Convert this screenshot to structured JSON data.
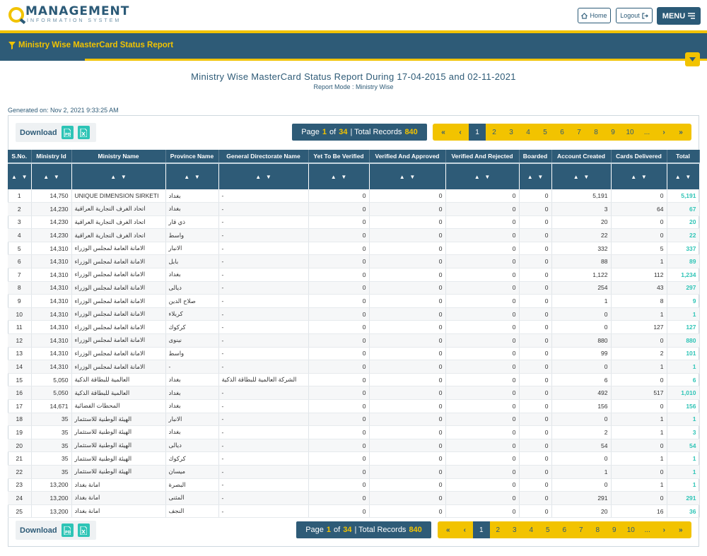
{
  "header": {
    "logo_main": "MANAGEMENT",
    "logo_sub": "INFORMATION SYSTEM",
    "home_label": "Home",
    "logout_label": "Logout",
    "menu_label": "MENU"
  },
  "titlebar": {
    "title": "Ministry Wise MasterCard Status Report"
  },
  "report": {
    "title": "Ministry Wise MasterCard Status Report During 17-04-2015 and 02-11-2021",
    "mode": "Report Mode : Ministry Wise",
    "generated": "Generated on: Nov 2, 2021 9:33:25 AM"
  },
  "download": {
    "label": "Download",
    "pdf_icon": "pdf-icon",
    "excel_icon": "excel-icon"
  },
  "paging": {
    "page_word": "Page",
    "page": "1",
    "of_word": "of",
    "pages": "34",
    "total_label": "| Total Records",
    "total": "840",
    "buttons": [
      "«",
      "‹",
      "1",
      "2",
      "3",
      "4",
      "5",
      "6",
      "7",
      "8",
      "9",
      "10",
      "...",
      "›",
      "»"
    ]
  },
  "table": {
    "headers": [
      "S.No.",
      "Ministry Id",
      "Ministry Name",
      "Province Name",
      "General Directorate Name",
      "Yet To Be Verified",
      "Verified And Approved",
      "Verified And Rejected",
      "Boarded",
      "Account Created",
      "Cards Delivered",
      "Total"
    ],
    "rows": [
      [
        "1",
        "14,750",
        "UNIQUE DIMENSION SIRKETI",
        "بغداد",
        "-",
        "0",
        "0",
        "0",
        "0",
        "5,191",
        "0",
        "5,191"
      ],
      [
        "2",
        "14,230",
        "اتحاد الغرف التجارية العراقية",
        "بغداد",
        "-",
        "0",
        "0",
        "0",
        "0",
        "3",
        "64",
        "67"
      ],
      [
        "3",
        "14,230",
        "اتحاد الغرف التجارية العراقية",
        "ذي قار",
        "-",
        "0",
        "0",
        "0",
        "0",
        "20",
        "0",
        "20"
      ],
      [
        "4",
        "14,230",
        "اتحاد الغرف التجارية العراقية",
        "واسط",
        "-",
        "0",
        "0",
        "0",
        "0",
        "22",
        "0",
        "22"
      ],
      [
        "5",
        "14,310",
        "الامانة العامة لمجلس الوزراء",
        "الانبار",
        "-",
        "0",
        "0",
        "0",
        "0",
        "332",
        "5",
        "337"
      ],
      [
        "6",
        "14,310",
        "الامانة العامة لمجلس الوزراء",
        "بابل",
        "-",
        "0",
        "0",
        "0",
        "0",
        "88",
        "1",
        "89"
      ],
      [
        "7",
        "14,310",
        "الامانة العامة لمجلس الوزراء",
        "بغداد",
        "-",
        "0",
        "0",
        "0",
        "0",
        "1,122",
        "112",
        "1,234"
      ],
      [
        "8",
        "14,310",
        "الامانة العامة لمجلس الوزراء",
        "ديالى",
        "-",
        "0",
        "0",
        "0",
        "0",
        "254",
        "43",
        "297"
      ],
      [
        "9",
        "14,310",
        "الامانة العامة لمجلس الوزراء",
        "صلاح الدين",
        "-",
        "0",
        "0",
        "0",
        "0",
        "1",
        "8",
        "9"
      ],
      [
        "10",
        "14,310",
        "الامانة العامة لمجلس الوزراء",
        "كربلاء",
        "-",
        "0",
        "0",
        "0",
        "0",
        "0",
        "1",
        "1"
      ],
      [
        "11",
        "14,310",
        "الامانة العامة لمجلس الوزراء",
        "كركوك",
        "-",
        "0",
        "0",
        "0",
        "0",
        "0",
        "127",
        "127"
      ],
      [
        "12",
        "14,310",
        "الامانة العامة لمجلس الوزراء",
        "نينوى",
        "-",
        "0",
        "0",
        "0",
        "0",
        "880",
        "0",
        "880"
      ],
      [
        "13",
        "14,310",
        "الامانة العامة لمجلس الوزراء",
        "واسط",
        "-",
        "0",
        "0",
        "0",
        "0",
        "99",
        "2",
        "101"
      ],
      [
        "14",
        "14,310",
        "الامانة العامة لمجلس الوزراء",
        "-",
        "-",
        "0",
        "0",
        "0",
        "0",
        "0",
        "1",
        "1"
      ],
      [
        "15",
        "5,050",
        "العالمية للبطاقة الذكية",
        "بغداد",
        "الشركة العالمية للبطاقة الذكية",
        "0",
        "0",
        "0",
        "0",
        "6",
        "0",
        "6"
      ],
      [
        "16",
        "5,050",
        "العالمية للبطاقة الذكية",
        "بغداد",
        "-",
        "0",
        "0",
        "0",
        "0",
        "492",
        "517",
        "1,010"
      ],
      [
        "17",
        "14,671",
        "المحطات الفضائية",
        "بغداد",
        "-",
        "0",
        "0",
        "0",
        "0",
        "156",
        "0",
        "156"
      ],
      [
        "18",
        "35",
        "الهيئة الوطنية للاستثمار",
        "الانبار",
        "-",
        "0",
        "0",
        "0",
        "0",
        "0",
        "1",
        "1"
      ],
      [
        "19",
        "35",
        "الهيئة الوطنية للاستثمار",
        "بغداد",
        "-",
        "0",
        "0",
        "0",
        "0",
        "2",
        "1",
        "3"
      ],
      [
        "20",
        "35",
        "الهيئة الوطنية للاستثمار",
        "ديالى",
        "-",
        "0",
        "0",
        "0",
        "0",
        "54",
        "0",
        "54"
      ],
      [
        "21",
        "35",
        "الهيئة الوطنية للاستثمار",
        "كركوك",
        "-",
        "0",
        "0",
        "0",
        "0",
        "0",
        "1",
        "1"
      ],
      [
        "22",
        "35",
        "الهيئة الوطنية للاستثمار",
        "ميسان",
        "-",
        "0",
        "0",
        "0",
        "0",
        "1",
        "0",
        "1"
      ],
      [
        "23",
        "13,200",
        "امانة بغداد",
        "البصرة",
        "-",
        "0",
        "0",
        "0",
        "0",
        "0",
        "1",
        "1"
      ],
      [
        "24",
        "13,200",
        "امانة بغداد",
        "المثنى",
        "-",
        "0",
        "0",
        "0",
        "0",
        "291",
        "0",
        "291"
      ],
      [
        "25",
        "13,200",
        "امانة بغداد",
        "النجف",
        "-",
        "0",
        "0",
        "0",
        "0",
        "20",
        "16",
        "36"
      ]
    ]
  },
  "colors": {
    "navy": "#2e5b77",
    "gold": "#f2c300",
    "teal": "#2ec4b6"
  }
}
